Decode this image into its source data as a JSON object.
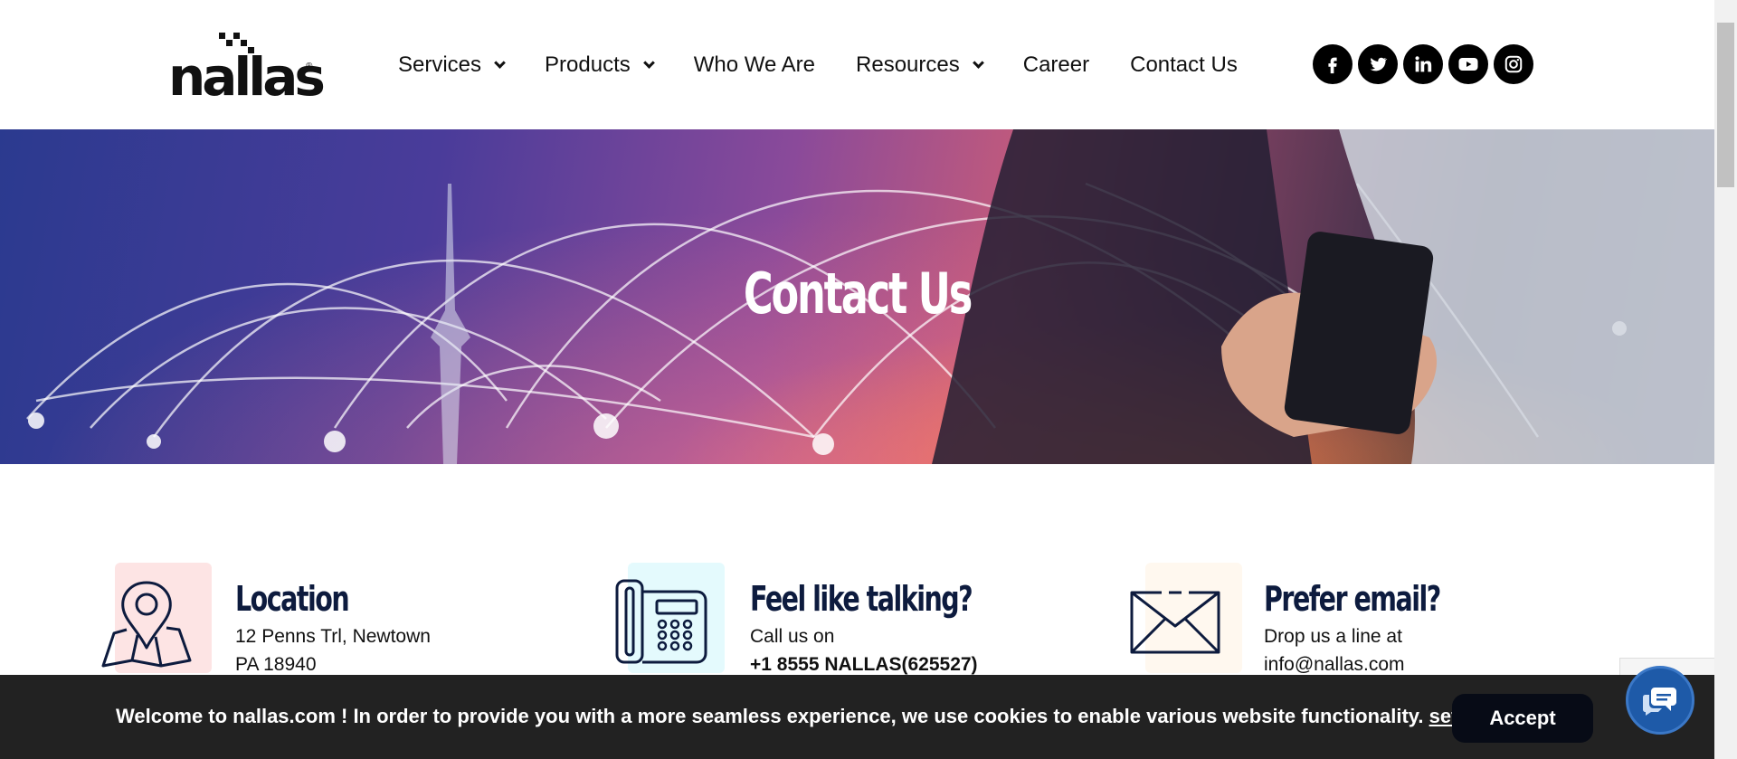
{
  "brand": {
    "logo_text": "nallas",
    "registered_mark": "®"
  },
  "nav": {
    "items": [
      {
        "label": "Services",
        "has_dropdown": true
      },
      {
        "label": "Products",
        "has_dropdown": true
      },
      {
        "label": "Who We Are",
        "has_dropdown": false
      },
      {
        "label": "Resources",
        "has_dropdown": true
      },
      {
        "label": "Career",
        "has_dropdown": false
      },
      {
        "label": "Contact Us",
        "has_dropdown": false
      }
    ],
    "social": [
      "facebook-icon",
      "twitter-icon",
      "linkedin-icon",
      "youtube-icon",
      "instagram-icon"
    ]
  },
  "hero": {
    "title": "Contact Us"
  },
  "contact": {
    "location": {
      "title": "Location",
      "line1": "12 Penns Trl, Newtown",
      "line2": "PA 18940",
      "icon": "map-pin-icon",
      "icon_bg": "#fde4e4"
    },
    "phone": {
      "title": "Feel like talking?",
      "line1": "Call us on",
      "line2": "+1 8555 NALLAS(625527)",
      "icon": "telephone-icon",
      "icon_bg": "#e4fafd"
    },
    "email": {
      "title": "Prefer email?",
      "line1": "Drop us a line at",
      "line2": "info@nallas.com",
      "icon": "envelope-icon",
      "icon_bg": "#fff8ef"
    }
  },
  "cookie": {
    "text": "Welcome to nallas.com ! In order to provide you with a more seamless experience, we use cookies to enable various website functionality. ",
    "link": "settings",
    "tail": ".",
    "accept_label": "Accept"
  },
  "colors": {
    "navy": "#0d1b3e",
    "cookie_bg": "#222222",
    "chat_blue": "#1e5aa8"
  }
}
